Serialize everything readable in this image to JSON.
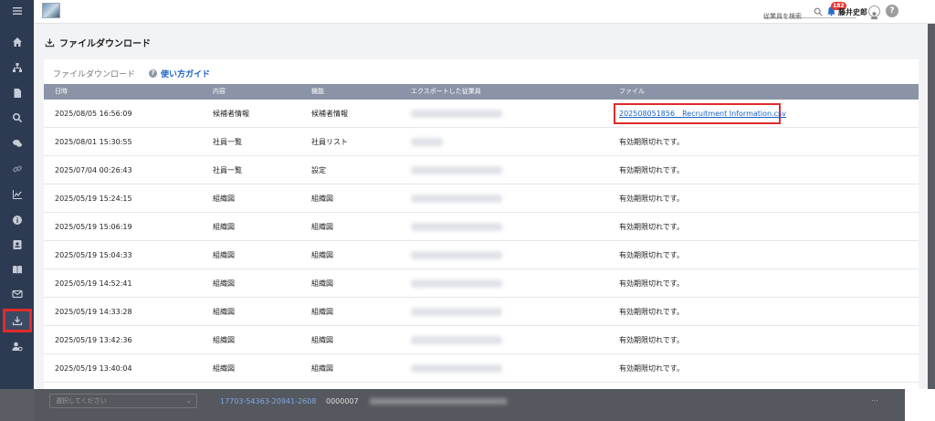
{
  "header": {
    "search_placeholder": "従業員を検索",
    "notification_count": "182",
    "user_name": "藤井史郎",
    "help_label": "?"
  },
  "page": {
    "title": "ファイルダウンロード"
  },
  "card": {
    "title": "ファイルダウンロード",
    "guide_label": "使い方ガイド"
  },
  "table": {
    "columns": [
      "日時",
      "内容",
      "機能",
      "エクスポートした従業員",
      "ファイル"
    ],
    "rows": [
      {
        "date": "2025/08/05 16:56:09",
        "content": "候補者情報",
        "function": "候補者情報",
        "file": "202508051856__Recruitment Information.csv"
      },
      {
        "date": "2025/08/01 15:30:55",
        "content": "社員一覧",
        "function": "社員リスト",
        "file": "有効期限切れです。"
      },
      {
        "date": "2025/07/04 00:26:43",
        "content": "社員一覧",
        "function": "設定",
        "file": "有効期限切れです。"
      },
      {
        "date": "2025/05/19 15:24:15",
        "content": "組織図",
        "function": "組織図",
        "file": "有効期限切れです。"
      },
      {
        "date": "2025/05/19 15:06:19",
        "content": "組織図",
        "function": "組織図",
        "file": "有効期限切れです。"
      },
      {
        "date": "2025/05/19 15:04:33",
        "content": "組織図",
        "function": "組織図",
        "file": "有効期限切れです。"
      },
      {
        "date": "2025/05/19 14:52:41",
        "content": "組織図",
        "function": "組織図",
        "file": "有効期限切れです。"
      },
      {
        "date": "2025/05/19 14:33:28",
        "content": "組織図",
        "function": "組織図",
        "file": "有効期限切れです。"
      },
      {
        "date": "2025/05/19 13:42:36",
        "content": "組織図",
        "function": "組織図",
        "file": "有効期限切れです。"
      },
      {
        "date": "2025/05/19 13:40:04",
        "content": "組織図",
        "function": "組織図",
        "file": "有効期限切れです。"
      }
    ]
  },
  "background_page": {
    "select_placeholder": "選択してください",
    "link": "17703-54363-20941-2608",
    "code": "0000007",
    "more": "..."
  },
  "colors": {
    "sidebar": "#2d3b52",
    "table_header": "#8a94a6",
    "link": "#1a62c4",
    "highlight": "#e02b2b"
  }
}
